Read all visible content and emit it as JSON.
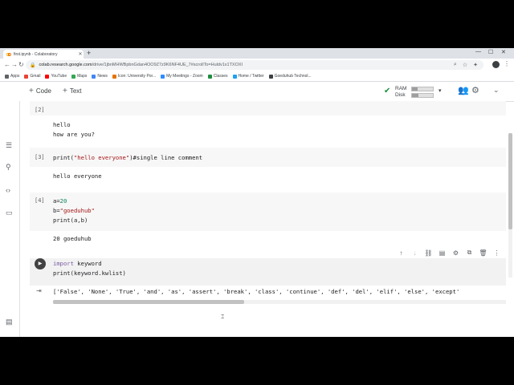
{
  "browser": {
    "tab_title": "first.ipynb - Colaboratory",
    "new_tab": "+",
    "url_host": "colab.research.google.com",
    "url_path": "/drive/1jbnMHWBpbnGdan4OO9Z7z9K6NF4UE_7#scrollTo=Huldv1x1TXOXI",
    "bookmarks": [
      {
        "label": "Apps",
        "color": "#5f6368"
      },
      {
        "label": "Gmail",
        "color": "#ea4335"
      },
      {
        "label": "YouTube",
        "color": "#ff0000"
      },
      {
        "label": "Maps",
        "color": "#34a853"
      },
      {
        "label": "News",
        "color": "#4285f4"
      },
      {
        "label": "Icon: University Por...",
        "color": "#e37400"
      },
      {
        "label": "My Meetings - Zoom",
        "color": "#2d8cff"
      },
      {
        "label": "Classes",
        "color": "#1e8e3e"
      },
      {
        "label": "Home / Twitter",
        "color": "#1da1f2"
      },
      {
        "label": "Goeduhub Technol...",
        "color": "#3c4043"
      }
    ]
  },
  "toolbar": {
    "code_label": "Code",
    "text_label": "Text",
    "ram_label": "RAM",
    "disk_label": "Disk",
    "ram_fill": 0.25,
    "disk_fill": 0.3
  },
  "cells": {
    "c2": {
      "prompt": "[2]",
      "output": "hello\nhow are you?"
    },
    "c3": {
      "prompt": "[3]",
      "code_fn": "print(",
      "code_str": "\"hello everyone\"",
      "code_rest": ")#single line comment",
      "output": "hello everyone"
    },
    "c4": {
      "prompt": "[4]",
      "l1a": "a=",
      "l1b": "20",
      "l2a": "b=",
      "l2b": "\"goeduhub\"",
      "l3": "print(a,b)",
      "output": "20 goeduhub"
    },
    "c5": {
      "l1k": "import",
      "l1r": " keyword",
      "l2": "print(keyword.kwlist)",
      "output": "['False', 'None', 'True', 'and', 'as', 'assert', 'break', 'class', 'continue', 'def', 'del', 'elif', 'else', 'except'"
    }
  }
}
